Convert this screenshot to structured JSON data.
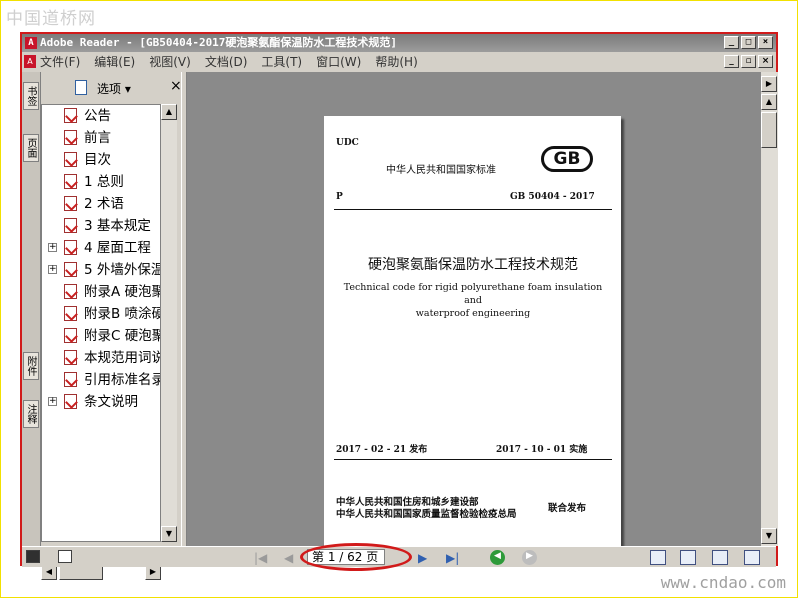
{
  "watermarks": {
    "top_left": "中国道桥网",
    "bottom_right": "www.cndao.com"
  },
  "window": {
    "title": "Adobe Reader - [GB50404-2017硬泡聚氨酯保温防水工程技术规范]"
  },
  "menu": {
    "items": [
      "文件(F)",
      "编辑(E)",
      "视图(V)",
      "文档(D)",
      "工具(T)",
      "窗口(W)",
      "帮助(H)"
    ]
  },
  "side_tabs": [
    "书签",
    "页面",
    "附件",
    "注释"
  ],
  "bookmarks_panel": {
    "options_label": "选项 ▾",
    "close_glyph": "×",
    "items": [
      {
        "label": "公告",
        "expandable": false
      },
      {
        "label": "前言",
        "expandable": false
      },
      {
        "label": "目次",
        "expandable": false
      },
      {
        "label": "1 总则",
        "expandable": false
      },
      {
        "label": "2 术语",
        "expandable": false
      },
      {
        "label": "3 基本规定",
        "expandable": false
      },
      {
        "label": "4 屋面工程",
        "expandable": true
      },
      {
        "label": "5 外墙外保温",
        "expandable": true
      },
      {
        "label": "附录A 硬泡聚",
        "expandable": false
      },
      {
        "label": "附录B 喷涂硬",
        "expandable": false
      },
      {
        "label": "附录C 硬泡聚",
        "expandable": false
      },
      {
        "label": "本规范用词说",
        "expandable": false
      },
      {
        "label": "引用标准名录",
        "expandable": false
      },
      {
        "label": "条文说明",
        "expandable": true
      }
    ]
  },
  "document_page": {
    "udc": "UDC",
    "national_standard": "中华人民共和国国家标准",
    "gb_logo": "GB",
    "p_code": "P",
    "standard_number": "GB 50404 - 2017",
    "title_zh": "硬泡聚氨酯保温防水工程技术规范",
    "title_en_line1": "Technical code for rigid polyurethane foam insulation and",
    "title_en_line2": "waterproof  engineering",
    "issue": "2017 - 02 - 21   发布",
    "implement": "2017 - 10 - 01   实施",
    "publisher1": "中华人民共和国住房和城乡建设部",
    "publisher2": "中华人民共和国国家质量监督检验检疫总局",
    "joint_publish": "联合发布"
  },
  "status": {
    "page_indicator": "第 1 / 62 页"
  },
  "colors": {
    "highlight_red": "#d11a1a",
    "nav_green": "#2e9a3a"
  }
}
